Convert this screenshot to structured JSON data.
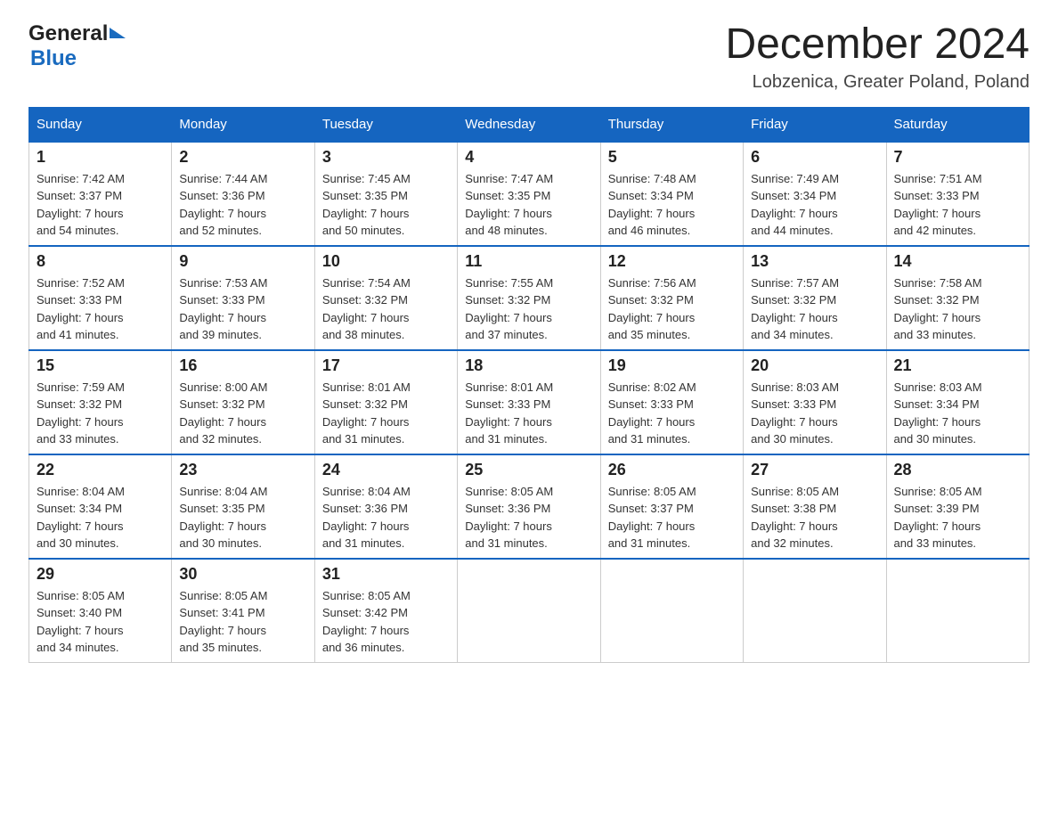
{
  "logo": {
    "general": "General",
    "blue": "Blue"
  },
  "header": {
    "title": "December 2024",
    "subtitle": "Lobzenica, Greater Poland, Poland"
  },
  "weekdays": [
    "Sunday",
    "Monday",
    "Tuesday",
    "Wednesday",
    "Thursday",
    "Friday",
    "Saturday"
  ],
  "weeks": [
    [
      {
        "day": "1",
        "sunrise": "7:42 AM",
        "sunset": "3:37 PM",
        "daylight": "7 hours and 54 minutes."
      },
      {
        "day": "2",
        "sunrise": "7:44 AM",
        "sunset": "3:36 PM",
        "daylight": "7 hours and 52 minutes."
      },
      {
        "day": "3",
        "sunrise": "7:45 AM",
        "sunset": "3:35 PM",
        "daylight": "7 hours and 50 minutes."
      },
      {
        "day": "4",
        "sunrise": "7:47 AM",
        "sunset": "3:35 PM",
        "daylight": "7 hours and 48 minutes."
      },
      {
        "day": "5",
        "sunrise": "7:48 AM",
        "sunset": "3:34 PM",
        "daylight": "7 hours and 46 minutes."
      },
      {
        "day": "6",
        "sunrise": "7:49 AM",
        "sunset": "3:34 PM",
        "daylight": "7 hours and 44 minutes."
      },
      {
        "day": "7",
        "sunrise": "7:51 AM",
        "sunset": "3:33 PM",
        "daylight": "7 hours and 42 minutes."
      }
    ],
    [
      {
        "day": "8",
        "sunrise": "7:52 AM",
        "sunset": "3:33 PM",
        "daylight": "7 hours and 41 minutes."
      },
      {
        "day": "9",
        "sunrise": "7:53 AM",
        "sunset": "3:33 PM",
        "daylight": "7 hours and 39 minutes."
      },
      {
        "day": "10",
        "sunrise": "7:54 AM",
        "sunset": "3:32 PM",
        "daylight": "7 hours and 38 minutes."
      },
      {
        "day": "11",
        "sunrise": "7:55 AM",
        "sunset": "3:32 PM",
        "daylight": "7 hours and 37 minutes."
      },
      {
        "day": "12",
        "sunrise": "7:56 AM",
        "sunset": "3:32 PM",
        "daylight": "7 hours and 35 minutes."
      },
      {
        "day": "13",
        "sunrise": "7:57 AM",
        "sunset": "3:32 PM",
        "daylight": "7 hours and 34 minutes."
      },
      {
        "day": "14",
        "sunrise": "7:58 AM",
        "sunset": "3:32 PM",
        "daylight": "7 hours and 33 minutes."
      }
    ],
    [
      {
        "day": "15",
        "sunrise": "7:59 AM",
        "sunset": "3:32 PM",
        "daylight": "7 hours and 33 minutes."
      },
      {
        "day": "16",
        "sunrise": "8:00 AM",
        "sunset": "3:32 PM",
        "daylight": "7 hours and 32 minutes."
      },
      {
        "day": "17",
        "sunrise": "8:01 AM",
        "sunset": "3:32 PM",
        "daylight": "7 hours and 31 minutes."
      },
      {
        "day": "18",
        "sunrise": "8:01 AM",
        "sunset": "3:33 PM",
        "daylight": "7 hours and 31 minutes."
      },
      {
        "day": "19",
        "sunrise": "8:02 AM",
        "sunset": "3:33 PM",
        "daylight": "7 hours and 31 minutes."
      },
      {
        "day": "20",
        "sunrise": "8:03 AM",
        "sunset": "3:33 PM",
        "daylight": "7 hours and 30 minutes."
      },
      {
        "day": "21",
        "sunrise": "8:03 AM",
        "sunset": "3:34 PM",
        "daylight": "7 hours and 30 minutes."
      }
    ],
    [
      {
        "day": "22",
        "sunrise": "8:04 AM",
        "sunset": "3:34 PM",
        "daylight": "7 hours and 30 minutes."
      },
      {
        "day": "23",
        "sunrise": "8:04 AM",
        "sunset": "3:35 PM",
        "daylight": "7 hours and 30 minutes."
      },
      {
        "day": "24",
        "sunrise": "8:04 AM",
        "sunset": "3:36 PM",
        "daylight": "7 hours and 31 minutes."
      },
      {
        "day": "25",
        "sunrise": "8:05 AM",
        "sunset": "3:36 PM",
        "daylight": "7 hours and 31 minutes."
      },
      {
        "day": "26",
        "sunrise": "8:05 AM",
        "sunset": "3:37 PM",
        "daylight": "7 hours and 31 minutes."
      },
      {
        "day": "27",
        "sunrise": "8:05 AM",
        "sunset": "3:38 PM",
        "daylight": "7 hours and 32 minutes."
      },
      {
        "day": "28",
        "sunrise": "8:05 AM",
        "sunset": "3:39 PM",
        "daylight": "7 hours and 33 minutes."
      }
    ],
    [
      {
        "day": "29",
        "sunrise": "8:05 AM",
        "sunset": "3:40 PM",
        "daylight": "7 hours and 34 minutes."
      },
      {
        "day": "30",
        "sunrise": "8:05 AM",
        "sunset": "3:41 PM",
        "daylight": "7 hours and 35 minutes."
      },
      {
        "day": "31",
        "sunrise": "8:05 AM",
        "sunset": "3:42 PM",
        "daylight": "7 hours and 36 minutes."
      },
      null,
      null,
      null,
      null
    ]
  ],
  "labels": {
    "sunrise": "Sunrise:",
    "sunset": "Sunset:",
    "daylight": "Daylight:"
  }
}
